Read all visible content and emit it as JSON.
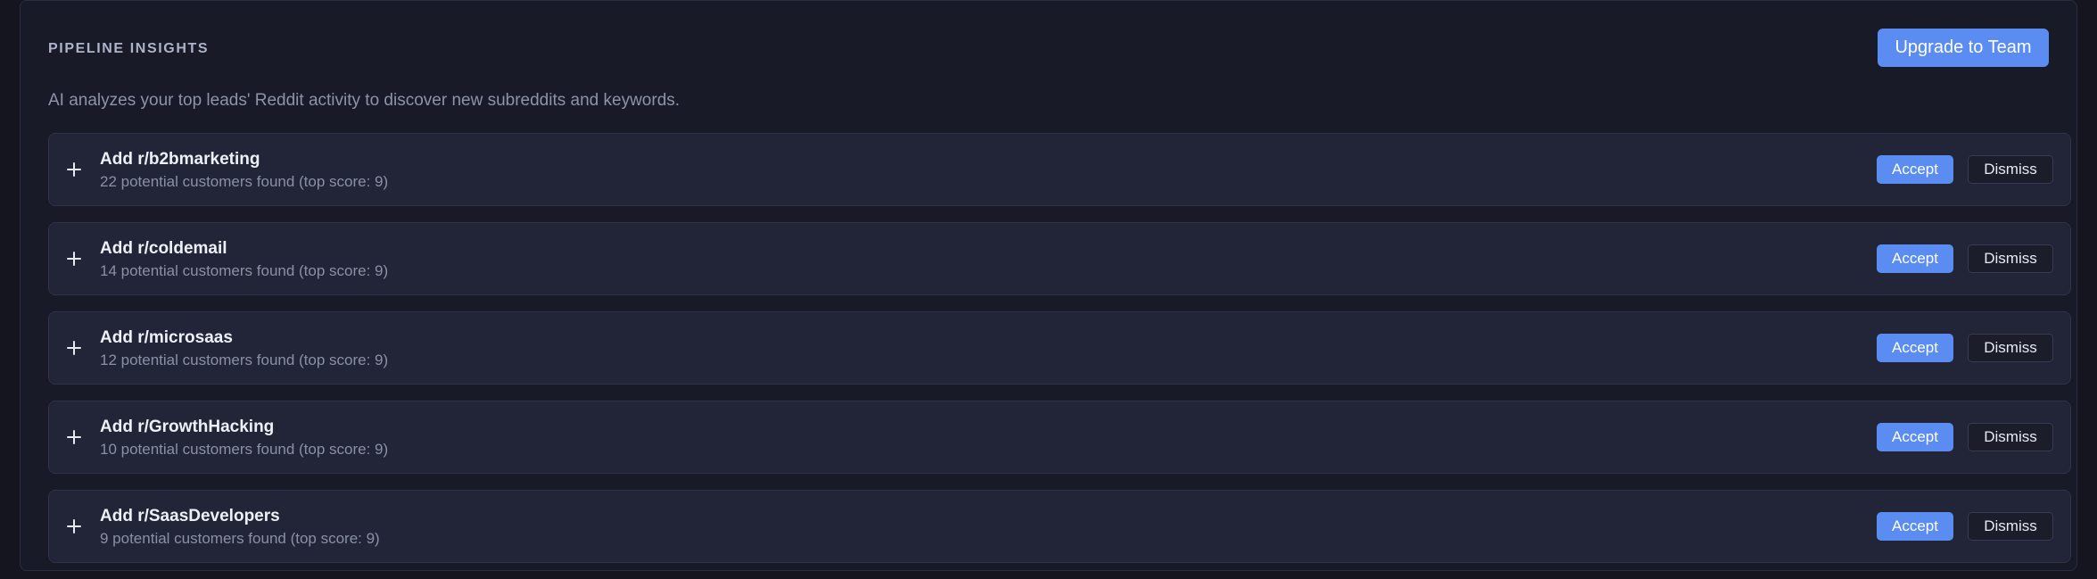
{
  "header": {
    "section_title": "PIPELINE INSIGHTS",
    "upgrade_label": "Upgrade to Team",
    "accent_color": "#5b8cf2"
  },
  "description": "AI analyzes your top leads' Reddit activity to discover new subreddits and keywords.",
  "suggestions": [
    {
      "icon": "plus-icon",
      "title": "Add r/b2bmarketing",
      "subtitle": "22 potential customers found (top score: 9)",
      "accept_label": "Accept",
      "dismiss_label": "Dismiss"
    },
    {
      "icon": "plus-icon",
      "title": "Add r/coldemail",
      "subtitle": "14 potential customers found (top score: 9)",
      "accept_label": "Accept",
      "dismiss_label": "Dismiss"
    },
    {
      "icon": "plus-icon",
      "title": "Add r/microsaas",
      "subtitle": "12 potential customers found (top score: 9)",
      "accept_label": "Accept",
      "dismiss_label": "Dismiss"
    },
    {
      "icon": "plus-icon",
      "title": "Add r/GrowthHacking",
      "subtitle": "10 potential customers found (top score: 9)",
      "accept_label": "Accept",
      "dismiss_label": "Dismiss"
    },
    {
      "icon": "plus-icon",
      "title": "Add r/SaasDevelopers",
      "subtitle": "9 potential customers found (top score: 9)",
      "accept_label": "Accept",
      "dismiss_label": "Dismiss"
    }
  ]
}
